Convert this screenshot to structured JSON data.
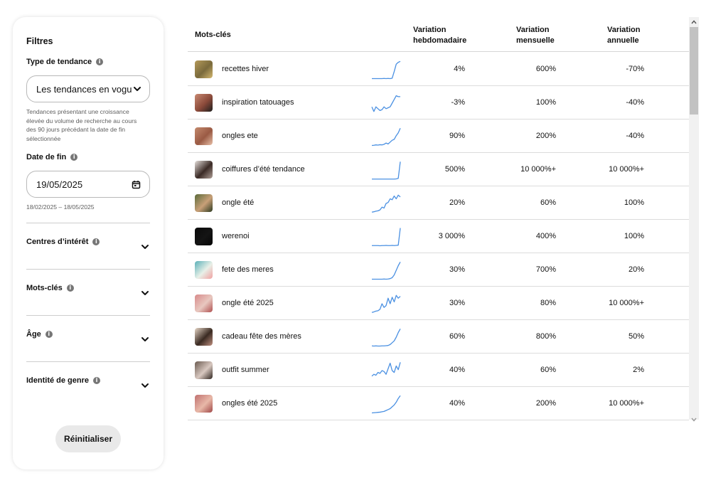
{
  "filters": {
    "title": "Filtres",
    "trend_type": {
      "label": "Type de tendance",
      "selected": "Les tendances en vogue",
      "description": "Tendances présentant une croissance élevée du volume de recherche au cours des 90 jours précédant la date de fin sélectionnée"
    },
    "end_date": {
      "label": "Date de fin",
      "value": "19/05/2025",
      "range": "18/02/2025 – 18/05/2025"
    },
    "sections": [
      {
        "label": "Centres d’intérêt"
      },
      {
        "label": "Mots-clés"
      },
      {
        "label": "Âge"
      },
      {
        "label": "Identité de genre"
      }
    ],
    "reset_label": "Réinitialiser"
  },
  "table": {
    "headers": {
      "keyword": "Mots-clés",
      "weekly_line1": "Variation",
      "weekly_line2": "hebdomadaire",
      "monthly_line1": "Variation",
      "monthly_line2": "mensuelle",
      "yearly_line1": "Variation",
      "yearly_line2": "annuelle"
    },
    "rows": [
      {
        "keyword": "recettes hiver",
        "weekly": "4%",
        "monthly": "600%",
        "yearly": "-70%",
        "thumb": [
          "#b59a5a",
          "#7a6a3c",
          "#d4b870"
        ],
        "trend": [
          0.02,
          0.02,
          0.02,
          0.02,
          0.02,
          0.02,
          0.03,
          0.02,
          0.03,
          0.02,
          0.04,
          0.4,
          0.8,
          0.9,
          0.95
        ]
      },
      {
        "keyword": "inspiration tatouages",
        "weekly": "-3%",
        "monthly": "100%",
        "yearly": "-40%",
        "thumb": [
          "#c98a72",
          "#8b4a3a",
          "#1e1e1e"
        ],
        "trend": [
          0.3,
          0.05,
          0.3,
          0.2,
          0.1,
          0.15,
          0.3,
          0.2,
          0.25,
          0.3,
          0.5,
          0.7,
          0.9,
          0.85,
          0.85
        ]
      },
      {
        "keyword": "ongles ete",
        "weekly": "90%",
        "monthly": "200%",
        "yearly": "-40%",
        "thumb": [
          "#c48a6e",
          "#9a5a44",
          "#e8c0a8"
        ],
        "trend": [
          0.02,
          0.03,
          0.05,
          0.04,
          0.06,
          0.05,
          0.08,
          0.15,
          0.1,
          0.2,
          0.3,
          0.35,
          0.55,
          0.7,
          0.95
        ]
      },
      {
        "keyword": "coiffures d’été tendance",
        "weekly": "500%",
        "monthly": "10 000%+",
        "yearly": "10 000%+",
        "thumb": [
          "#e6e0dc",
          "#3a2a25",
          "#b0a098"
        ],
        "trend": [
          0.01,
          0.01,
          0.01,
          0.01,
          0.01,
          0.01,
          0.01,
          0.01,
          0.01,
          0.01,
          0.01,
          0.01,
          0.02,
          0.05,
          0.95
        ]
      },
      {
        "keyword": "ongle été",
        "weekly": "20%",
        "monthly": "60%",
        "yearly": "100%",
        "thumb": [
          "#5a6a3a",
          "#c8a078",
          "#2c3a20"
        ],
        "trend": [
          0.03,
          0.05,
          0.08,
          0.1,
          0.15,
          0.3,
          0.25,
          0.5,
          0.55,
          0.75,
          0.7,
          0.9,
          0.75,
          0.95,
          0.85
        ]
      },
      {
        "keyword": "werenoi",
        "weekly": "3 000%",
        "monthly": "400%",
        "yearly": "100%",
        "thumb": [
          "#0a0a0a",
          "#141414",
          "#050505"
        ],
        "trend": [
          0.03,
          0.03,
          0.03,
          0.03,
          0.02,
          0.03,
          0.03,
          0.04,
          0.03,
          0.03,
          0.04,
          0.03,
          0.04,
          0.05,
          0.98
        ]
      },
      {
        "keyword": "fete des meres",
        "weekly": "30%",
        "monthly": "700%",
        "yearly": "20%",
        "thumb": [
          "#5ab0b8",
          "#e8f0e8",
          "#f0a0a0"
        ],
        "trend": [
          0.02,
          0.02,
          0.02,
          0.02,
          0.02,
          0.02,
          0.03,
          0.02,
          0.03,
          0.05,
          0.1,
          0.25,
          0.5,
          0.75,
          0.95
        ]
      },
      {
        "keyword": "ongle été 2025",
        "weekly": "30%",
        "monthly": "80%",
        "yearly": "10 000%+",
        "thumb": [
          "#d88a8a",
          "#e8c8c0",
          "#b05050"
        ],
        "trend": [
          0.03,
          0.06,
          0.1,
          0.12,
          0.2,
          0.5,
          0.3,
          0.4,
          0.8,
          0.5,
          0.85,
          0.6,
          0.95,
          0.8,
          0.9
        ]
      },
      {
        "keyword": "cadeau fête des mères",
        "weekly": "60%",
        "monthly": "800%",
        "yearly": "50%",
        "thumb": [
          "#e8d8c8",
          "#3a2a22",
          "#c09080"
        ],
        "trend": [
          0.03,
          0.02,
          0.03,
          0.02,
          0.02,
          0.03,
          0.03,
          0.04,
          0.05,
          0.1,
          0.2,
          0.3,
          0.5,
          0.75,
          0.95
        ]
      },
      {
        "keyword": "outfit summer",
        "weekly": "40%",
        "monthly": "60%",
        "yearly": "2%",
        "thumb": [
          "#6a5a50",
          "#d8c8c0",
          "#302620"
        ],
        "trend": [
          0.2,
          0.3,
          0.25,
          0.4,
          0.35,
          0.5,
          0.45,
          0.3,
          0.6,
          0.9,
          0.5,
          0.4,
          0.75,
          0.55,
          0.95
        ]
      },
      {
        "keyword": "ongles été 2025",
        "weekly": "40%",
        "monthly": "200%",
        "yearly": "10 000%+",
        "thumb": [
          "#c07070",
          "#e8b8a8",
          "#a04848"
        ],
        "trend": [
          0.02,
          0.03,
          0.04,
          0.05,
          0.06,
          0.08,
          0.1,
          0.15,
          0.2,
          0.25,
          0.35,
          0.45,
          0.6,
          0.8,
          0.95
        ]
      }
    ]
  },
  "colors": {
    "sparkline": "#4a90e2",
    "info_icon": "#767676"
  }
}
